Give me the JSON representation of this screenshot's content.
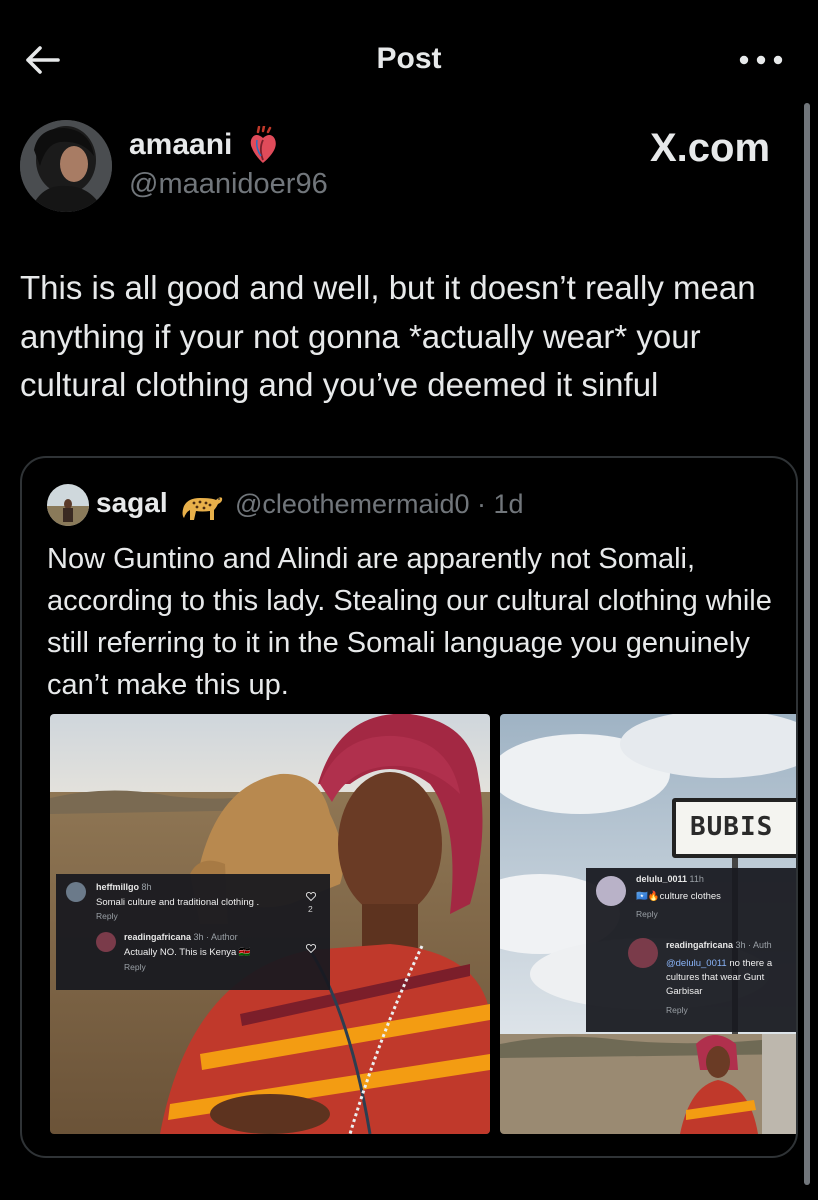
{
  "header": {
    "title": "Post",
    "back_icon": "arrow-left-icon",
    "more_icon": "more-horizontal-icon"
  },
  "post": {
    "author_name": "amaani",
    "author_badge_icon": "anatomical-heart-emoji",
    "author_handle": "@maanidoer96",
    "watermark": "X.com",
    "text": "This is all good and well, but it doesn’t really mean anything if your not gonna *actually wear* your cultural clothing and you’ve deemed it sinful"
  },
  "quote": {
    "author_name": "sagal",
    "author_badge_icon": "leopard-emoji",
    "meta": "@cleothemermaid0 · 1d",
    "text": "Now Guntino and Alindi are apparently not Somali, according to this lady. Stealing our cultural clothing while still referring to it in the Somali language you genuinely can’t make this up."
  },
  "media": {
    "image1": {
      "comment1": {
        "user": "heffmillgo",
        "time": "8h",
        "text": "Somali culture and traditional clothing .",
        "reply": "Reply",
        "likes": "2"
      },
      "comment2": {
        "user": "readingafricana",
        "meta": "3h · Author",
        "text": "Actually NO. This is Kenya 🇰🇪",
        "reply": "Reply"
      }
    },
    "image2": {
      "sign_text": "BUBIS",
      "comment1": {
        "user": "delulu_0011",
        "time": "11h",
        "text": "🇸🇴🔥culture clothes",
        "reply": "Reply"
      },
      "comment2": {
        "user": "readingafricana",
        "meta": "3h · Auth",
        "mention": "@delulu_0011",
        "text_line1": " no there a",
        "text_line2": "cultures that wear Gunt",
        "text_line3": "Garbisar",
        "reply": "Reply"
      }
    }
  },
  "colors": {
    "background": "#000000",
    "text_primary": "#e7e9ea",
    "text_secondary": "#71767b",
    "border": "#2f3336"
  }
}
